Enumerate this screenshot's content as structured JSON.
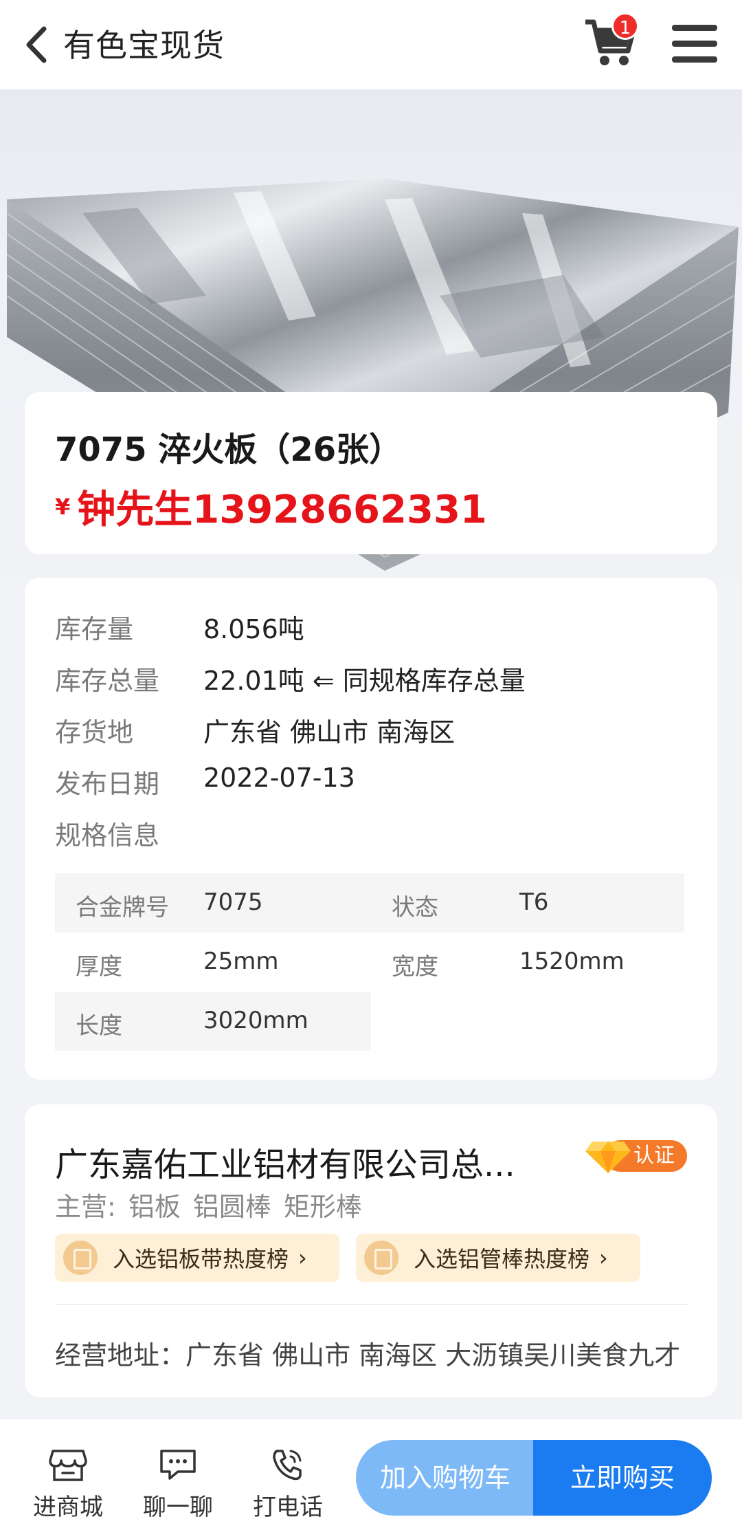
{
  "header": {
    "title": "有色宝现货",
    "cart_badge": "1"
  },
  "product": {
    "name": "7075 淬火板（26张）",
    "currency": "¥",
    "contact": "钟先生13928662331"
  },
  "specs": {
    "rows": [
      {
        "key": "库存量",
        "value": "8.056吨"
      },
      {
        "key": "库存总量",
        "value": "22.01吨 ⇐ 同规格库存总量"
      },
      {
        "key": "存货地",
        "value": "广东省 佛山市 南海区"
      },
      {
        "key": "发布日期",
        "value": "2022-07-13"
      },
      {
        "key": "规格信息",
        "value": ""
      }
    ],
    "table": {
      "alloy_label": "合金牌号",
      "alloy_value": "7075",
      "state_label": "状态",
      "state_value": "T6",
      "thickness_label": "厚度",
      "thickness_value": "25mm",
      "width_label": "宽度",
      "width_value": "1520mm",
      "length_label": "长度",
      "length_value": "3020mm"
    }
  },
  "company": {
    "name": "广东嘉佑工业铝材有限公司总...",
    "verified_label": "认证",
    "main_label": "主营:",
    "main_items": [
      "铝板",
      "铝圆棒",
      "矩形棒"
    ],
    "rank1": "入选铝板带热度榜",
    "rank2": "入选铝管棒热度榜",
    "address": "经营地址：广东省 佛山市 南海区 大沥镇吴川美食九才"
  },
  "bottom_bar": {
    "store": "进商城",
    "chat": "聊一聊",
    "call": "打电话",
    "add_cart": "加入购物车",
    "buy_now": "立即购买"
  },
  "colors": {
    "price_red": "#e5141a",
    "primary_blue": "#1a7cf0",
    "light_blue": "#7db9f7",
    "verify_orange": "#f47a2a"
  }
}
